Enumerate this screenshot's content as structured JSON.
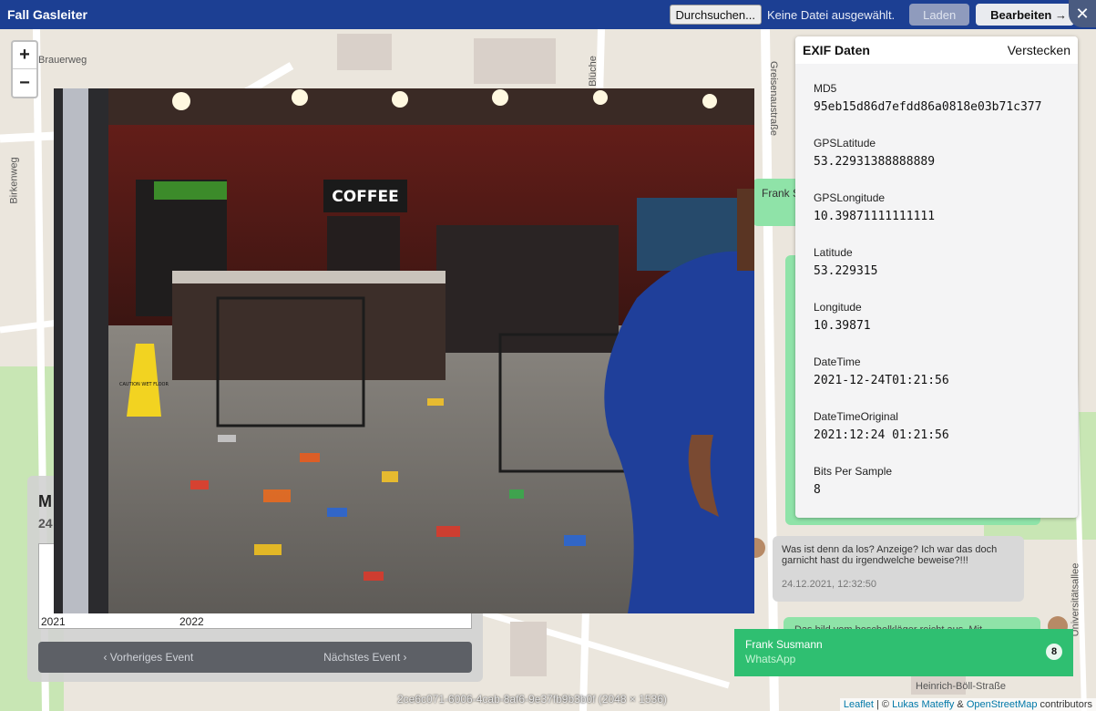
{
  "app": {
    "title": "Fall Gasleiter"
  },
  "toolbar": {
    "browse_label": "Durchsuchen...",
    "no_file_label": "Keine Datei ausgewählt.",
    "load_label": "Laden",
    "edit_label": "Bearbeiten",
    "edit_arrow": "→",
    "close_label": "✕"
  },
  "map": {
    "zoom_in": "+",
    "zoom_out": "−",
    "streets": [
      "Brauerweg",
      "Birkenweg",
      "Blüche",
      "Greisenaustraße",
      "Universitätsallee",
      "Heinrich-Böll-Straße"
    ],
    "attribution": {
      "leaflet": "Leaflet",
      "sep": " | © ",
      "author": "Lukas Mateffy",
      "amp": " & ",
      "osm": "OpenStreetMap",
      "suffix": " contributors"
    }
  },
  "timeline": {
    "title": "M",
    "subtitle": "24",
    "years": [
      "2021",
      "2022"
    ],
    "prev_label": "‹  Vorheriges Event",
    "next_label": "Nächstes Event  ›"
  },
  "chat": {
    "partial_name": "Frank S",
    "message": {
      "text": "Was ist denn da los? Anzeige? Ich war das doch garnicht hast du irgendwelche beweise?!!!",
      "timestamp": "24.12.2021, 12:32:50"
    },
    "reply_preview": "Das bild vom beschelkläger reicht aus. Mit"
  },
  "contact": {
    "name": "Frank Susmann",
    "channel": "WhatsApp",
    "count": "8"
  },
  "viewer": {
    "caption": "2ce6c071-6006-4cab-8af6-9e37fb9b3b0f (2048 × 1536)",
    "photo_signs": {
      "coffee": "COFFEE",
      "wet_floor": "CAUTION WET FLOOR"
    }
  },
  "exif": {
    "title": "EXIF Daten",
    "hide_label": "Verstecken",
    "entries": [
      {
        "key": "MD5",
        "value": "95eb15d86d7efdd86a0818e03b71c377"
      },
      {
        "key": "GPSLatitude",
        "value": "53.22931388888889"
      },
      {
        "key": "GPSLongitude",
        "value": "10.39871111111111"
      },
      {
        "key": "Latitude",
        "value": "53.229315"
      },
      {
        "key": "Longitude",
        "value": "10.39871"
      },
      {
        "key": "DateTime",
        "value": "2021-12-24T01:21:56"
      },
      {
        "key": "DateTimeOriginal",
        "value": "2021:12:24 01:21:56"
      },
      {
        "key": "Bits Per Sample",
        "value": "8"
      }
    ]
  }
}
